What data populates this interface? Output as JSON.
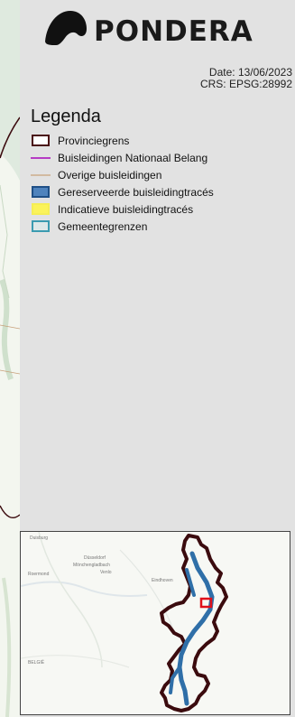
{
  "logo": {
    "name": "PONDERA"
  },
  "meta": {
    "date": "Date: 13/06/2023",
    "crs": "CRS: EPSG:28992"
  },
  "legend": {
    "title": "Legenda",
    "items": [
      {
        "label": "Provinciegrens",
        "symbol": "box",
        "stroke": "#4a0f12",
        "fill": "#ffffff"
      },
      {
        "label": "Buisleidingen Nationaal Belang",
        "symbol": "line",
        "stroke": "#b63cc4"
      },
      {
        "label": "Overige buisleidingen",
        "symbol": "line",
        "stroke": "#c9a27a"
      },
      {
        "label": "Gereserveerde buisleidingtracés",
        "symbol": "box",
        "stroke": "#1f4f86",
        "fill": "#4f83bd"
      },
      {
        "label": "Indicatieve buisleidingtracés",
        "symbol": "box",
        "stroke": "#f5ee55",
        "fill": "#fbf35a"
      },
      {
        "label": "Gemeentegrenzen",
        "symbol": "box",
        "stroke": "#3b9bb0",
        "fill": "#dde8e8"
      }
    ]
  },
  "inset": {
    "place_labels": [
      "Duisburg",
      "Mönchengladbach",
      "Roermond",
      "Venlo",
      "Düsseldorf",
      "Eindhoven",
      "BELGIË"
    ]
  },
  "colors": {
    "province": "#4a0f12",
    "route": "#2f6fa8",
    "highlight": "#e0101a",
    "panel": "#e2e2e2"
  }
}
